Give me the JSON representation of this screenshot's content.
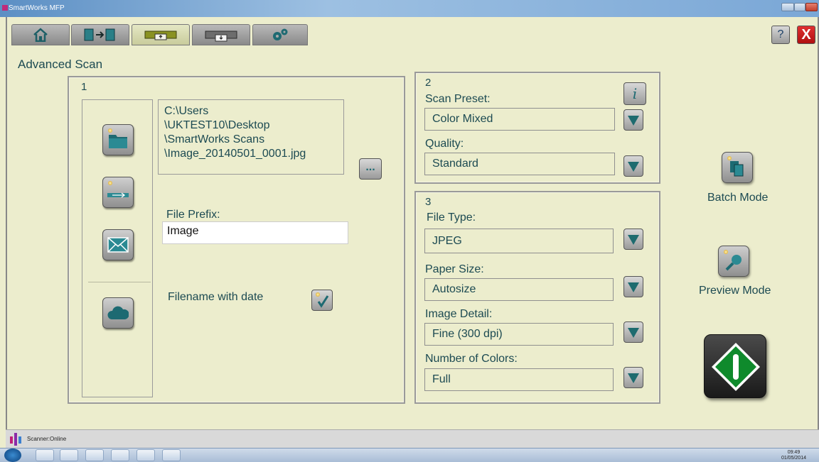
{
  "window": {
    "title": "SmartWorks MFP"
  },
  "header": {
    "tabs": [
      {
        "name": "home",
        "icon": "home-icon"
      },
      {
        "name": "copy",
        "icon": "copy-icon"
      },
      {
        "name": "scan",
        "icon": "scan-icon",
        "active": true
      },
      {
        "name": "print",
        "icon": "print-icon"
      },
      {
        "name": "settings",
        "icon": "gears-icon"
      }
    ],
    "help_label": "?",
    "exit_label": "X"
  },
  "page": {
    "title": "Advanced Scan"
  },
  "panel1": {
    "number": "1",
    "destinations": [
      "folder-icon",
      "usb-icon",
      "email-icon",
      "cloud-icon"
    ],
    "path_lines": [
      "C:\\Users",
      "\\UKTEST10\\Desktop",
      "\\SmartWorks Scans",
      "\\Image_20140501_0001.jpg"
    ],
    "browse_label": "...",
    "file_prefix_label": "File Prefix:",
    "file_prefix_value": "Image",
    "filename_with_date_label": "Filename with date",
    "filename_with_date_checked": true
  },
  "panel2": {
    "number": "2",
    "info_label": "i",
    "scan_preset_label": "Scan Preset:",
    "scan_preset_value": "Color Mixed",
    "quality_label": "Quality:",
    "quality_value": "Standard"
  },
  "panel3": {
    "number": "3",
    "file_type_label": "File Type:",
    "file_type_value": "JPEG",
    "paper_size_label": "Paper Size:",
    "paper_size_value": "Autosize",
    "image_detail_label": "Image Detail:",
    "image_detail_value": "Fine (300 dpi)",
    "number_of_colors_label": "Number of Colors:",
    "number_of_colors_value": "Full"
  },
  "side": {
    "batch_mode_label": "Batch Mode",
    "preview_mode_label": "Preview Mode"
  },
  "status": {
    "scanner": "Scanner:Online"
  },
  "taskbar": {
    "time": "09:49",
    "date": "01/05/2014"
  },
  "colors": {
    "accent_teal": "#1c4a52",
    "background": "#ECEDCD",
    "start_green": "#0f8a2c",
    "exit_red": "#c81e1e"
  }
}
